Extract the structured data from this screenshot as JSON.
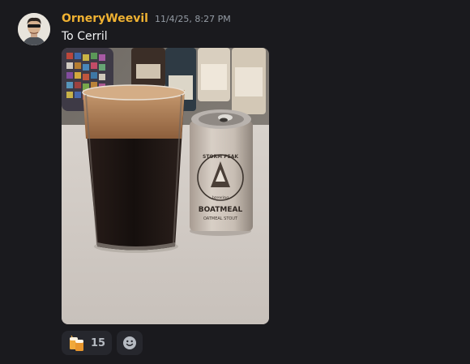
{
  "message": {
    "author": "OrneryWeevil",
    "timestamp": "11/4/25, 8:27 PM",
    "text": "To Cerril",
    "author_color": "#f0b232"
  },
  "attachment": {
    "can": {
      "brand": "STORM PEAK",
      "sub": "brewing",
      "product": "BOATMEAL",
      "style": "OATMEAL STOUT"
    }
  },
  "reactions": [
    {
      "icon": "beer-mugs-icon",
      "count": "15"
    },
    {
      "icon": "add-reaction-icon"
    }
  ]
}
